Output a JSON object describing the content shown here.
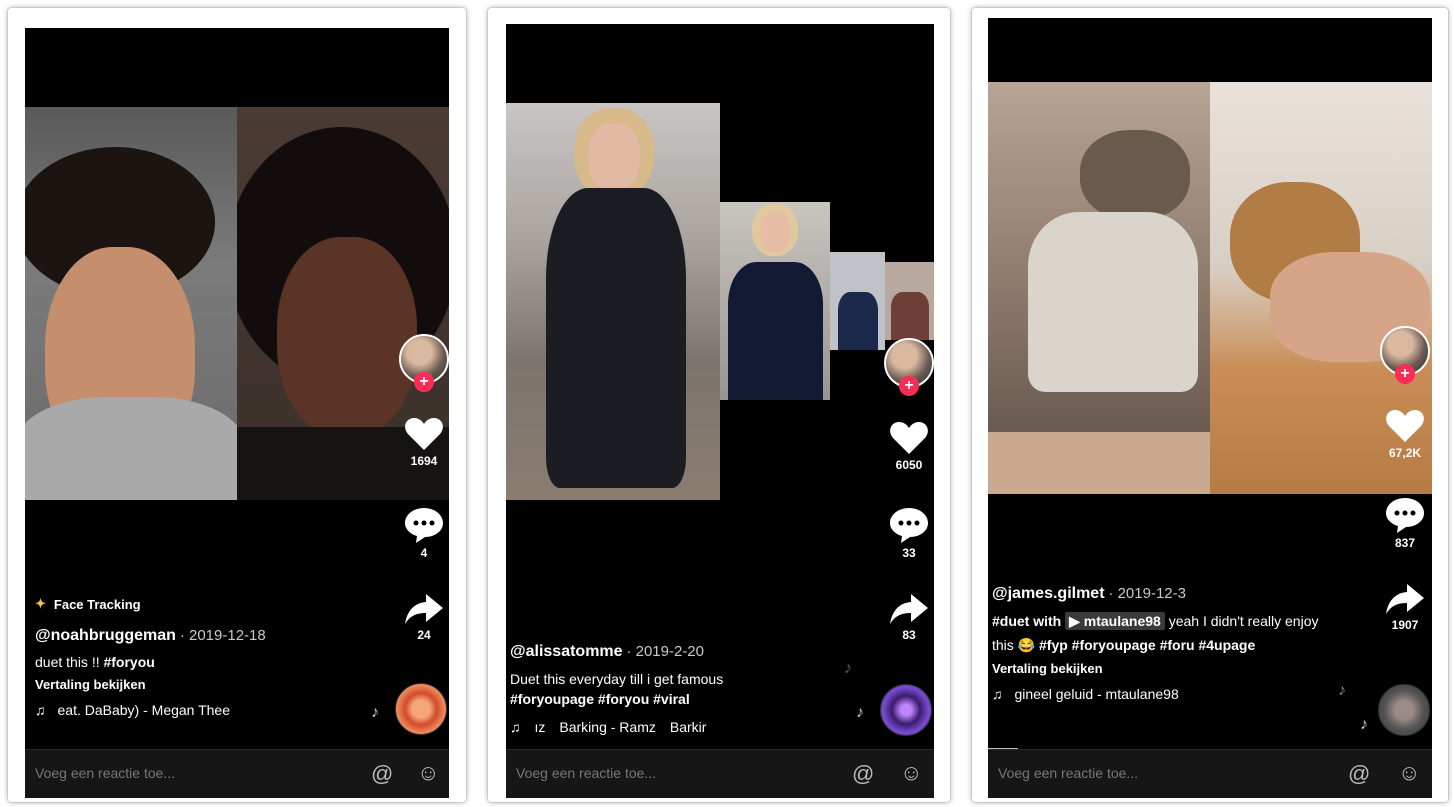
{
  "common": {
    "comment_placeholder": "Voeg een reactie toe...",
    "at_icon": "@",
    "emoji_icon": "☺",
    "translate_label": "Vertaling bekijken",
    "music_note": "♫",
    "accent_color": "#fe2c55"
  },
  "panels": [
    {
      "effect_label": "Face Tracking",
      "username": "@noahbruggeman",
      "date": "2019-12-18",
      "caption": "duet this !! ",
      "tags": "#foryou",
      "music_text": "eat. DaBaby) - Megan Thee",
      "likes": "1694",
      "comments": "4",
      "shares": "24"
    },
    {
      "username": "@alissatomme",
      "date": "2019-2-20",
      "caption": "Duet this everyday till i get famous",
      "tags": "#foryoupage #foryou #viral",
      "music_part1": "ız",
      "music_part2": "Barking - Ramz",
      "music_part3": "Barkir",
      "likes": "6050",
      "comments": "33",
      "shares": "83"
    },
    {
      "username": "@james.gilmet",
      "date": "2019-12-3",
      "caption_prefix": "#duet with",
      "chip": "▶ mtaulane98",
      "caption_rest": "yeah I didn't really enjoy this 😂",
      "tags": "#fyp #foryoupage #foru #4upage",
      "music_text": "gineel geluid - mtaulane98",
      "likes": "67,2K",
      "comments": "837",
      "shares": "1907"
    }
  ]
}
